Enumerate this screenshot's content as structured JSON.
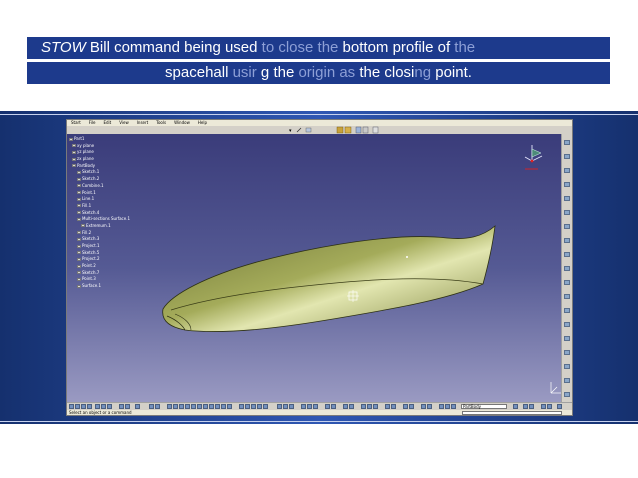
{
  "caption": {
    "line1_italic": "STOW",
    "line1_rest": " Bill  command  being  used ",
    "line1_muted1": "to close the",
    "line1_mid": " bottom  profile  of ",
    "line1_muted2": "the",
    "line2_a": "spacehall ",
    "line2_muted1": " usir",
    "line2_b": " g the ",
    "line2_muted2": "origin as",
    "line2_c": " the closi",
    "line2_muted3": "ng",
    "line2_d": " point."
  },
  "app": {
    "menu": [
      "Start",
      "File",
      "Edit",
      "View",
      "Insert",
      "Tools",
      "Window",
      "Help"
    ],
    "tree": [
      "Part1",
      "xy plane",
      "yz plane",
      "zx plane",
      "PartBody",
      "Sketch.1",
      "Sketch.2",
      "Combine.1",
      "Point.1",
      "Line.1",
      "Fill.1",
      "Sketch.4",
      "Multi-sections Surface.1",
      "Extremum.1",
      "Fill.2",
      "Sketch.3",
      "Project.1",
      "Sketch.5",
      "Project.2",
      "Point.2",
      "Sketch.7",
      "Point.3",
      "Surface.1"
    ],
    "status_text": "Select an object or a command",
    "combo_value": "PartBody"
  },
  "colors": {
    "caption_bg": "#1d3a8c",
    "muted_text": "#8d9fd6",
    "shape_fill": "#8c9446"
  }
}
